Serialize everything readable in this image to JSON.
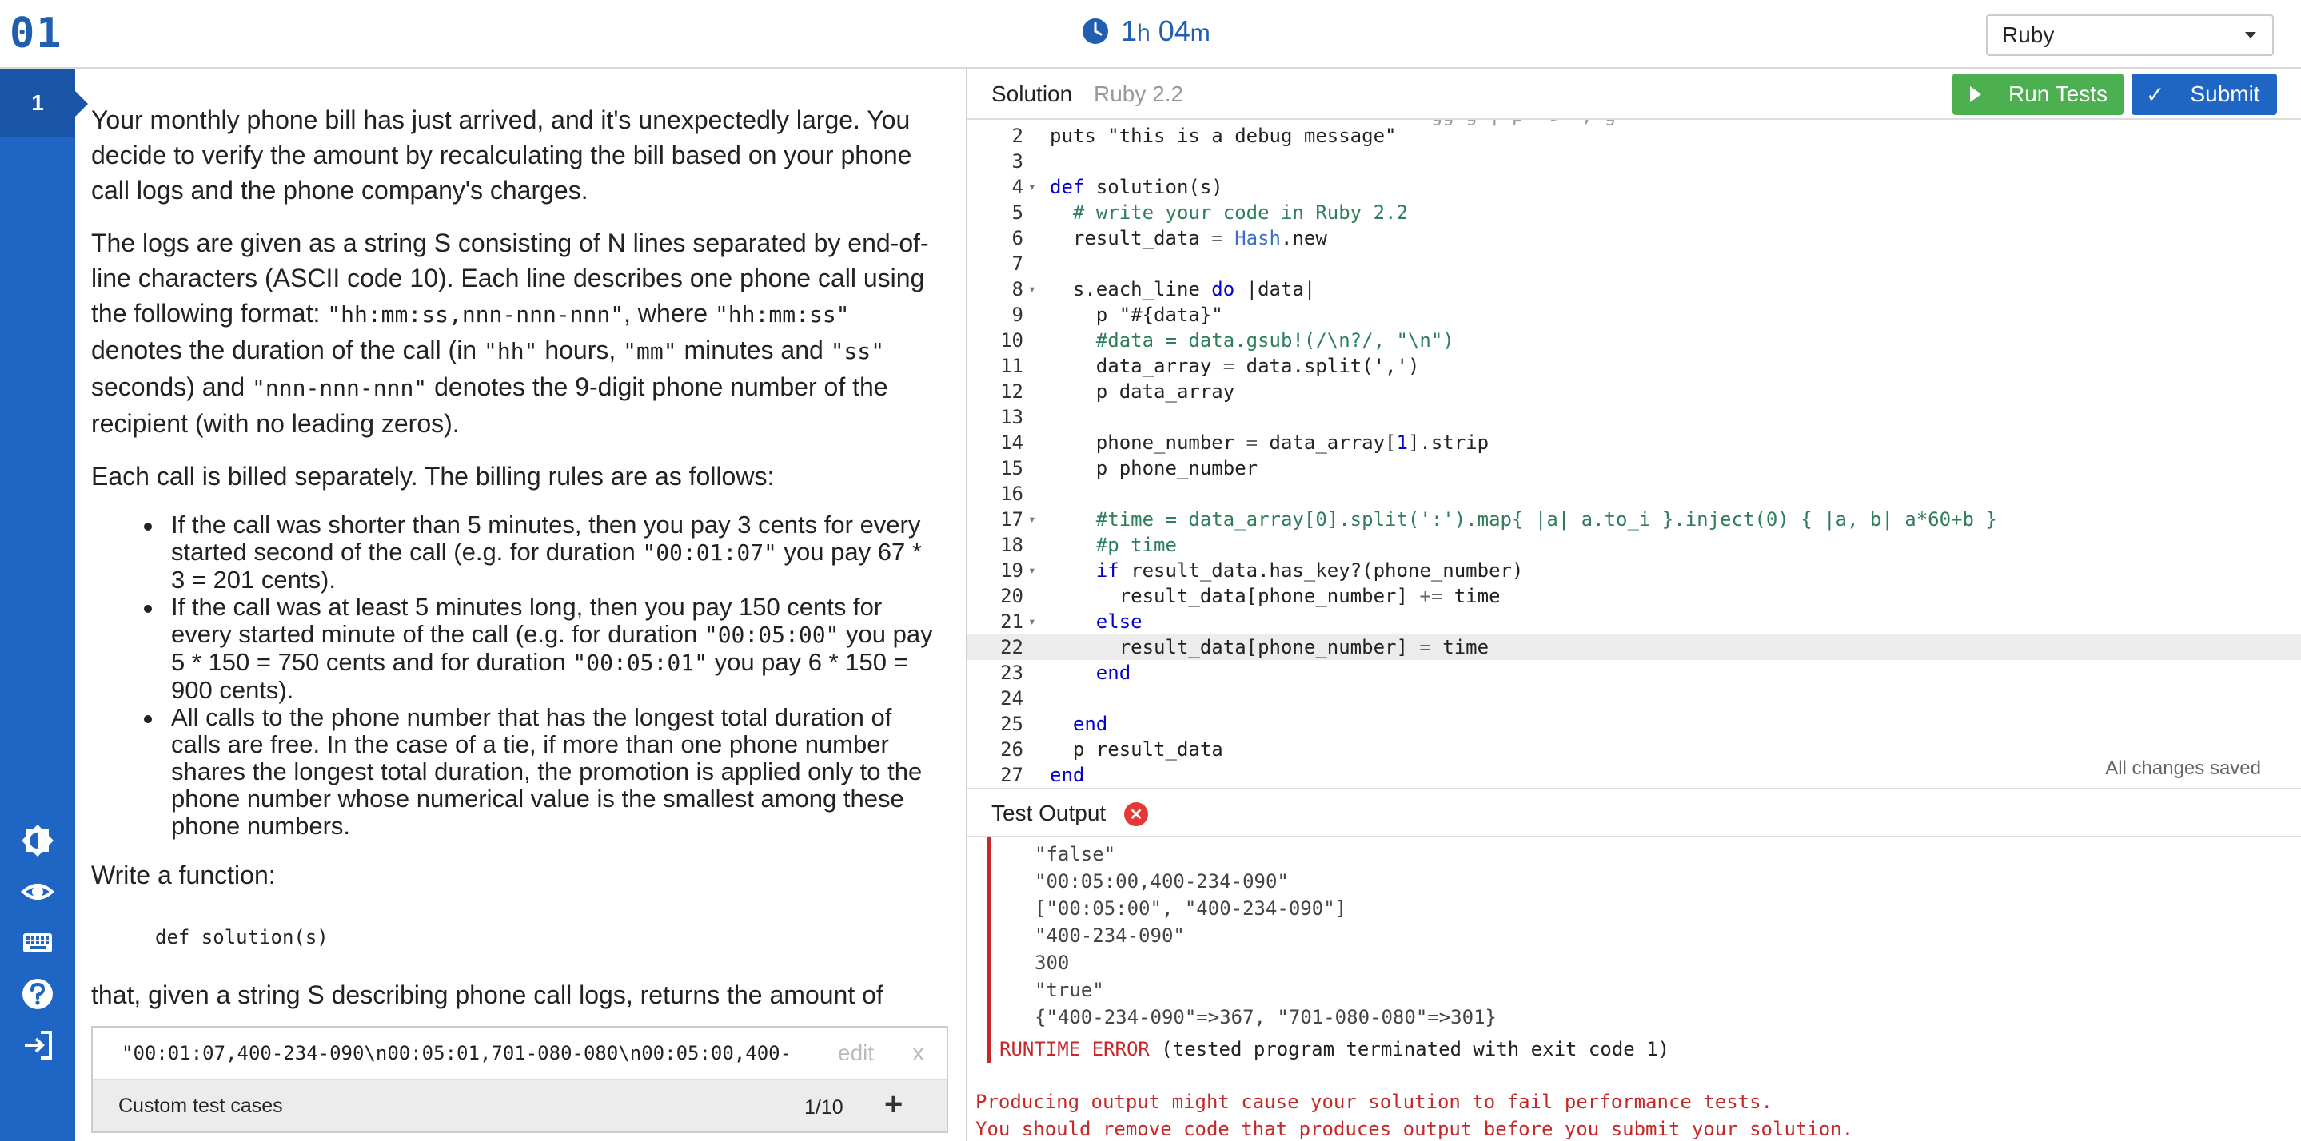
{
  "header": {
    "logo": "01",
    "timer_hours": "1",
    "timer_h_unit": "h",
    "timer_minutes": "04",
    "timer_m_unit": "m",
    "language": "Ruby"
  },
  "sidebar": {
    "task_number": "1",
    "icons": [
      "brightness-icon",
      "eye-icon",
      "keyboard-icon",
      "help-icon",
      "logout-icon"
    ]
  },
  "problem": {
    "p1": "Your monthly phone bill has just arrived, and it's unexpectedly large. You decide to verify the amount by recalculating the bill based on your phone call logs and the phone company's charges.",
    "p2_a": "The logs are given as a string S consisting of N lines separated by end-of-line characters (ASCII code 10). Each line describes one phone call using the following format: ",
    "p2_code1": "\"hh:mm:ss,nnn-nnn-nnn\"",
    "p2_b": ", where ",
    "p2_code2": "\"hh:mm:ss\"",
    "p2_c": " denotes the duration of the call (in ",
    "p2_code3": "\"hh\"",
    "p2_d": " hours, ",
    "p2_code4": "\"mm\"",
    "p2_e": " minutes and ",
    "p2_code5": "\"ss\"",
    "p2_f": " seconds) and ",
    "p2_code6": "\"nnn-nnn-nnn\"",
    "p2_g": " denotes the 9-digit phone number of the recipient (with no leading zeros).",
    "p3": "Each call is billed separately. The billing rules are as follows:",
    "rule1_a": "If the call was shorter than 5 minutes, then you pay 3 cents for every started second of the call (e.g. for duration ",
    "rule1_code": "\"00:01:07\"",
    "rule1_b": " you pay 67 * 3 = 201 cents).",
    "rule2_a": "If the call was at least 5 minutes long, then you pay 150 cents for every started minute of the call (e.g. for duration ",
    "rule2_code1": "\"00:05:00\"",
    "rule2_b": " you pay 5 * 150 = 750 cents and for duration ",
    "rule2_code2": "\"00:05:01\"",
    "rule2_c": " you pay 6 * 150 = 900 cents).",
    "rule3": "All calls to the phone number that has the longest total duration of calls are free. In the case of a tie, if more than one phone number shares the longest total duration, the promotion is applied only to the phone number whose numerical value is the smallest among these phone numbers.",
    "p4": "Write a function:",
    "signature": "def solution(s)",
    "p5": "that, given a string S describing phone call logs, returns the amount of"
  },
  "test_cases": {
    "input": "\"00:01:07,400-234-090\\n00:05:01,701-080-080\\n00:05:00,400-",
    "edit_label": "edit",
    "remove_label": "x",
    "footer_label": "Custom test cases",
    "count": "1/10",
    "add_label": "+"
  },
  "solution": {
    "title": "Solution",
    "version": "Ruby 2.2",
    "run_label": "Run Tests",
    "submit_label": "Submit",
    "saved_status": "All changes saved",
    "partial_first_line": "                                 gg g | p  t  , g",
    "lines": [
      {
        "n": "2",
        "fold": "",
        "text": "puts \"this is a debug message\""
      },
      {
        "n": "3",
        "fold": "",
        "text": ""
      },
      {
        "n": "4",
        "fold": "▾",
        "text": "def solution(s)"
      },
      {
        "n": "5",
        "fold": "",
        "text": "  # write your code in Ruby 2.2"
      },
      {
        "n": "6",
        "fold": "",
        "text": "  result_data = Hash.new"
      },
      {
        "n": "7",
        "fold": "",
        "text": ""
      },
      {
        "n": "8",
        "fold": "▾",
        "text": "  s.each_line do |data|"
      },
      {
        "n": "9",
        "fold": "",
        "text": "    p \"#{data}\""
      },
      {
        "n": "10",
        "fold": "",
        "text": "    #data = data.gsub!(/\\n?/, \"\\n\")"
      },
      {
        "n": "11",
        "fold": "",
        "text": "    data_array = data.split(',')"
      },
      {
        "n": "12",
        "fold": "",
        "text": "    p data_array"
      },
      {
        "n": "13",
        "fold": "",
        "text": ""
      },
      {
        "n": "14",
        "fold": "",
        "text": "    phone_number = data_array[1].strip"
      },
      {
        "n": "15",
        "fold": "",
        "text": "    p phone_number"
      },
      {
        "n": "16",
        "fold": "",
        "text": ""
      },
      {
        "n": "17",
        "fold": "▾",
        "text": "    #time = data_array[0].split(':').map{ |a| a.to_i }.inject(0) { |a, b| a*60+b }"
      },
      {
        "n": "18",
        "fold": "",
        "text": "    #p time"
      },
      {
        "n": "19",
        "fold": "▾",
        "text": "    if result_data.has_key?(phone_number)"
      },
      {
        "n": "20",
        "fold": "",
        "text": "      result_data[phone_number] += time"
      },
      {
        "n": "21",
        "fold": "▾",
        "text": "    else"
      },
      {
        "n": "22",
        "fold": "",
        "text": "      result_data[phone_number] = time"
      },
      {
        "n": "23",
        "fold": "",
        "text": "    end"
      },
      {
        "n": "24",
        "fold": "",
        "text": ""
      },
      {
        "n": "25",
        "fold": "",
        "text": "  end"
      },
      {
        "n": "26",
        "fold": "",
        "text": "  p result_data"
      },
      {
        "n": "27",
        "fold": "",
        "text": "end"
      }
    ],
    "active_line": "22"
  },
  "output": {
    "title": "Test Output",
    "lines": [
      "\"false\"",
      "\"00:05:00,400-234-090\"",
      "[\"00:05:00\", \"400-234-090\"]",
      "\"400-234-090\"",
      "300",
      "\"true\"",
      "{\"400-234-090\"=>367, \"701-080-080\"=>301}"
    ],
    "runtime_label": "RUNTIME ERROR",
    "runtime_detail": " (tested program terminated with exit code 1)",
    "warning_1": "Producing output might cause your solution to fail performance tests.",
    "warning_2": "You should remove code that produces output before you submit your solution."
  },
  "colors": {
    "brand": "#1f5eb0",
    "sidebar": "#1f65c4",
    "run_button": "#4caf50",
    "submit_button": "#1f65c4",
    "error": "#c62828"
  }
}
